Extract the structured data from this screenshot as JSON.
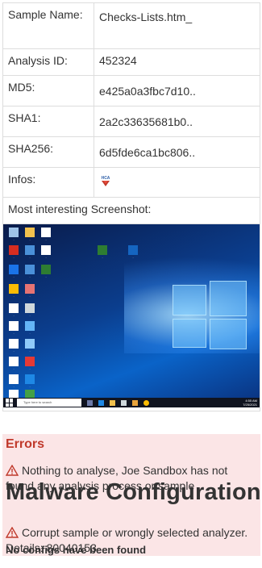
{
  "info": {
    "sample_name_label": "Sample Name:",
    "sample_name_value": "Checks-Lists.htm_",
    "analysis_id_label": "Analysis ID:",
    "analysis_id_value": "452324",
    "md5_label": "MD5:",
    "md5_value": "e425a0a3fbc7d10..",
    "sha1_label": "SHA1:",
    "sha1_value": "2a2c33635681b0..",
    "sha256_label": "SHA256:",
    "sha256_value": "6d5fde6ca1bc806..",
    "infos_label": "Infos:",
    "infos_badge": "HCA",
    "screenshot_label": "Most interesting Screenshot:"
  },
  "screenshot": {
    "search_placeholder": "Type here to search",
    "tray_time": "4:55 AM",
    "tray_date": "7/25/2021"
  },
  "errors": {
    "title": "Errors",
    "items": [
      "Nothing to analyse, Joe Sandbox has not found any analysis process or sample",
      "Corrupt sample or wrongly selected analyzer. Details: 80040153"
    ]
  },
  "malware_config": {
    "title": "Malware Configuration",
    "no_configs": "No configs have been found"
  },
  "colors": {
    "error_bg": "#fbe5e6",
    "error_title": "#c0392b",
    "warning_icon": "#c0392b",
    "border": "#dddddd"
  },
  "icons": [
    "warning-icon",
    "hca-badge-icon",
    "windows-start-icon"
  ]
}
